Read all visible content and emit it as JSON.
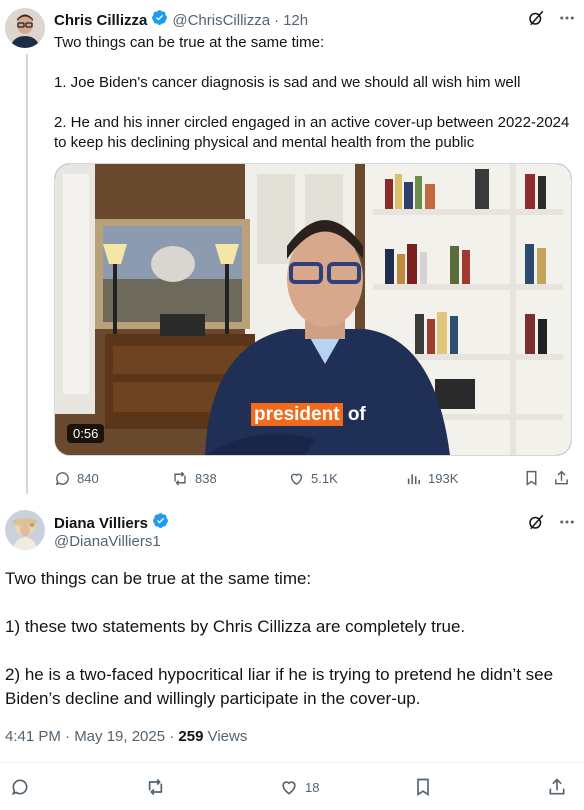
{
  "tweet1": {
    "name": "Chris Cillizza",
    "handle": "@ChrisCillizza",
    "sep": "·",
    "time": "12h",
    "text": "Two things can be true at the same time:\n\n1. Joe Biden's cancer diagnosis is sad and we should all wish him well\n\n2. He and his inner circled engaged in an active cover-up between 2022-2024 to keep his declining physical and mental health from the public",
    "video": {
      "duration": "0:56",
      "caption_highlight": "president",
      "caption_rest": "of"
    },
    "actions": {
      "replies": "840",
      "reposts": "838",
      "likes": "5.1K",
      "views": "193K"
    }
  },
  "tweet2": {
    "name": "Diana Villiers",
    "handle": "@DianaVilliers1",
    "text": "Two things can be true at the same time:\n\n1) these two statements by Chris Cillizza are completely true.\n\n2) he is a two-faced hypocritical liar if he is trying to pretend he didn’t see Biden’s decline and willingly participate in the cover-up.",
    "timestamp": "4:41 PM · May 19, 2025 · ",
    "views_count": "259",
    "views_label": " Views",
    "actions": {
      "likes": "18"
    }
  },
  "colors": {
    "verified": "#1d9bf0",
    "secondary": "#536471",
    "caption_bg": "#f26b1d"
  },
  "icons": [
    "verified-badge-icon",
    "grok-icon",
    "more-icon",
    "reply-icon",
    "repost-icon",
    "like-icon",
    "views-icon",
    "bookmark-icon",
    "share-icon"
  ]
}
